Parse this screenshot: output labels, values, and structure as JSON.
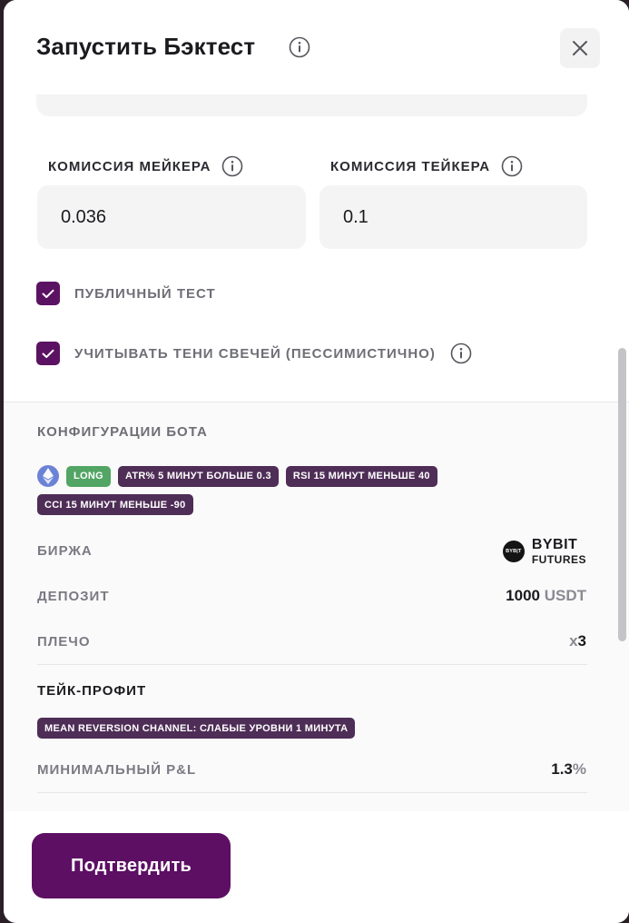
{
  "dialog": {
    "title": "Запустить Бэктест",
    "icons": {
      "info": "info-circle-icon",
      "close": "close-x-icon"
    }
  },
  "fees": {
    "maker_label": "КОМИССИЯ МЕЙКЕРА",
    "maker_value": "0.036",
    "taker_label": "КОМИССИЯ ТЕЙКЕРА",
    "taker_value": "0.1"
  },
  "options": {
    "public_test_label": "ПУБЛИЧНЫЙ ТЕСТ",
    "public_test_checked": true,
    "candle_shadows_label": "УЧИТЫВАТЬ ТЕНИ СВЕЧЕЙ (ПЕССИМИСТИЧНО)",
    "candle_shadows_checked": true
  },
  "bot_config": {
    "title": "КОНФИГУРАЦИИ БОТА",
    "coin_icon": "ethereum-icon",
    "direction": "LONG",
    "conditions": [
      "ATR% 5 МИНУТ БОЛЬШЕ 0.3",
      "RSI 15 МИНУТ МЕНЬШЕ 40",
      "CCI 15 МИНУТ МЕНЬШЕ -90"
    ],
    "exchange_label": "БИРЖА",
    "exchange_logo_text": "BYB|T",
    "exchange_name": "BYBIT",
    "exchange_market": "FUTURES",
    "deposit_label": "ДЕПОЗИТ",
    "deposit_amount": "1000",
    "deposit_currency": "USDT",
    "leverage_label": "ПЛЕЧО",
    "leverage_prefix": "x",
    "leverage_value": "3"
  },
  "take_profit": {
    "title": "ТЕЙК-ПРОФИТ",
    "condition": "MEAN REVERSION CHANNEL: СЛАБЫЕ УРОВНИ 1 МИНУТА",
    "min_pnl_label": "МИНИМАЛЬНЫЙ P&L",
    "min_pnl_value": "1.3",
    "min_pnl_unit": "%"
  },
  "footer": {
    "confirm_label": "Подтвердить"
  },
  "colors": {
    "accent": "#5c0f63",
    "long_tag": "#52a564",
    "condition_tag": "#4e2d56",
    "eth": "#6c82d6"
  }
}
